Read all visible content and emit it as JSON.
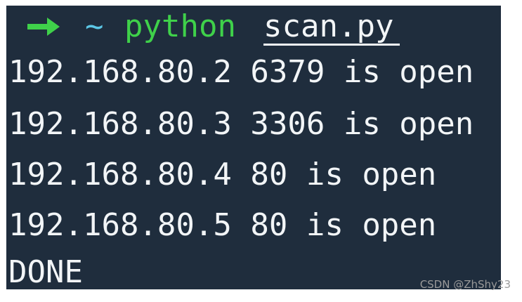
{
  "terminal": {
    "prompt": {
      "arrow_icon": "right-arrow-icon",
      "arrow_color": "#3fd14a",
      "cwd": "~",
      "command": "python",
      "argument": "scan.py"
    },
    "output_lines": [
      "192.168.80.2 6379 is open",
      "192.168.80.3 3306 is open",
      "192.168.80.4 80 is open",
      "192.168.80.5 80 is open",
      "DONE"
    ],
    "colors": {
      "background": "#1f2d3d",
      "text": "#f2f5f7",
      "cwd": "#5cc7e6",
      "command": "#3fd14a"
    }
  },
  "watermark": "CSDN @ZhShy23"
}
